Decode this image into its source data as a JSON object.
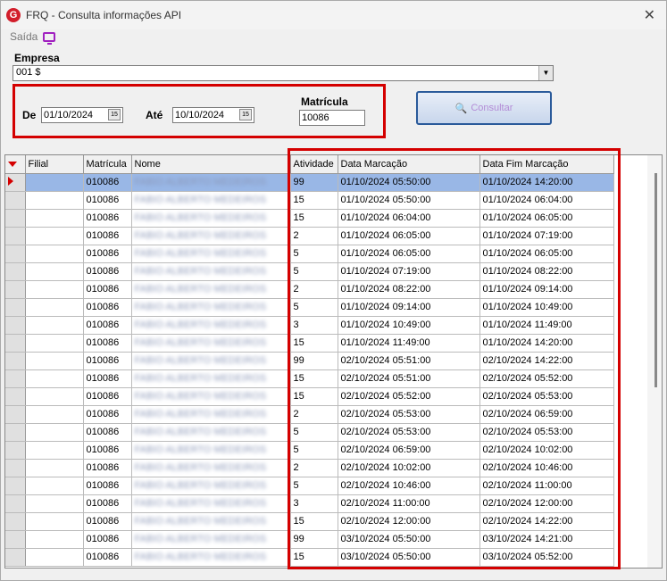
{
  "window": {
    "title": "FRQ - Consulta informações API",
    "icon_letter": "G"
  },
  "menu": {
    "saida_label": "Saída"
  },
  "empresa": {
    "label": "Empresa",
    "value": "001 $"
  },
  "filters": {
    "de_label": "De",
    "de_value": "01/10/2024",
    "ate_label": "Até",
    "ate_value": "10/10/2024",
    "matricula_label": "Matrícula",
    "matricula_value": "10086",
    "consultar_label": "Consultar"
  },
  "grid": {
    "columns": [
      "Filial",
      "Matrícula",
      "Nome",
      "Atividade",
      "Data Marcação",
      "Data Fim Marcação"
    ],
    "rows": [
      {
        "filial": "",
        "matricula": "010086",
        "nome": "FABIO ALBERTO MEDEIROS",
        "atividade": "99",
        "inicio": "01/10/2024 05:50:00",
        "fim": "01/10/2024 14:20:00"
      },
      {
        "filial": "",
        "matricula": "010086",
        "nome": "FABIO ALBERTO MEDEIROS",
        "atividade": "15",
        "inicio": "01/10/2024 05:50:00",
        "fim": "01/10/2024 06:04:00"
      },
      {
        "filial": "",
        "matricula": "010086",
        "nome": "FABIO ALBERTO MEDEIROS",
        "atividade": "15",
        "inicio": "01/10/2024 06:04:00",
        "fim": "01/10/2024 06:05:00"
      },
      {
        "filial": "",
        "matricula": "010086",
        "nome": "FABIO ALBERTO MEDEIROS",
        "atividade": "2",
        "inicio": "01/10/2024 06:05:00",
        "fim": "01/10/2024 07:19:00"
      },
      {
        "filial": "",
        "matricula": "010086",
        "nome": "FABIO ALBERTO MEDEIROS",
        "atividade": "5",
        "inicio": "01/10/2024 06:05:00",
        "fim": "01/10/2024 06:05:00"
      },
      {
        "filial": "",
        "matricula": "010086",
        "nome": "FABIO ALBERTO MEDEIROS",
        "atividade": "5",
        "inicio": "01/10/2024 07:19:00",
        "fim": "01/10/2024 08:22:00"
      },
      {
        "filial": "",
        "matricula": "010086",
        "nome": "FABIO ALBERTO MEDEIROS",
        "atividade": "2",
        "inicio": "01/10/2024 08:22:00",
        "fim": "01/10/2024 09:14:00"
      },
      {
        "filial": "",
        "matricula": "010086",
        "nome": "FABIO ALBERTO MEDEIROS",
        "atividade": "5",
        "inicio": "01/10/2024 09:14:00",
        "fim": "01/10/2024 10:49:00"
      },
      {
        "filial": "",
        "matricula": "010086",
        "nome": "FABIO ALBERTO MEDEIROS",
        "atividade": "3",
        "inicio": "01/10/2024 10:49:00",
        "fim": "01/10/2024 11:49:00"
      },
      {
        "filial": "",
        "matricula": "010086",
        "nome": "FABIO ALBERTO MEDEIROS",
        "atividade": "15",
        "inicio": "01/10/2024 11:49:00",
        "fim": "01/10/2024 14:20:00"
      },
      {
        "filial": "",
        "matricula": "010086",
        "nome": "FABIO ALBERTO MEDEIROS",
        "atividade": "99",
        "inicio": "02/10/2024 05:51:00",
        "fim": "02/10/2024 14:22:00"
      },
      {
        "filial": "",
        "matricula": "010086",
        "nome": "FABIO ALBERTO MEDEIROS",
        "atividade": "15",
        "inicio": "02/10/2024 05:51:00",
        "fim": "02/10/2024 05:52:00"
      },
      {
        "filial": "",
        "matricula": "010086",
        "nome": "FABIO ALBERTO MEDEIROS",
        "atividade": "15",
        "inicio": "02/10/2024 05:52:00",
        "fim": "02/10/2024 05:53:00"
      },
      {
        "filial": "",
        "matricula": "010086",
        "nome": "FABIO ALBERTO MEDEIROS",
        "atividade": "2",
        "inicio": "02/10/2024 05:53:00",
        "fim": "02/10/2024 06:59:00"
      },
      {
        "filial": "",
        "matricula": "010086",
        "nome": "FABIO ALBERTO MEDEIROS",
        "atividade": "5",
        "inicio": "02/10/2024 05:53:00",
        "fim": "02/10/2024 05:53:00"
      },
      {
        "filial": "",
        "matricula": "010086",
        "nome": "FABIO ALBERTO MEDEIROS",
        "atividade": "5",
        "inicio": "02/10/2024 06:59:00",
        "fim": "02/10/2024 10:02:00"
      },
      {
        "filial": "",
        "matricula": "010086",
        "nome": "FABIO ALBERTO MEDEIROS",
        "atividade": "2",
        "inicio": "02/10/2024 10:02:00",
        "fim": "02/10/2024 10:46:00"
      },
      {
        "filial": "",
        "matricula": "010086",
        "nome": "FABIO ALBERTO MEDEIROS",
        "atividade": "5",
        "inicio": "02/10/2024 10:46:00",
        "fim": "02/10/2024 11:00:00"
      },
      {
        "filial": "",
        "matricula": "010086",
        "nome": "FABIO ALBERTO MEDEIROS",
        "atividade": "3",
        "inicio": "02/10/2024 11:00:00",
        "fim": "02/10/2024 12:00:00"
      },
      {
        "filial": "",
        "matricula": "010086",
        "nome": "FABIO ALBERTO MEDEIROS",
        "atividade": "15",
        "inicio": "02/10/2024 12:00:00",
        "fim": "02/10/2024 14:22:00"
      },
      {
        "filial": "",
        "matricula": "010086",
        "nome": "FABIO ALBERTO MEDEIROS",
        "atividade": "99",
        "inicio": "03/10/2024 05:50:00",
        "fim": "03/10/2024 14:21:00"
      },
      {
        "filial": "",
        "matricula": "010086",
        "nome": "FABIO ALBERTO MEDEIROS",
        "atividade": "15",
        "inicio": "03/10/2024 05:50:00",
        "fim": "03/10/2024 05:52:00"
      }
    ]
  },
  "colors": {
    "highlight": "#d40000",
    "selection": "#99b7e6",
    "accent": "#a020c0"
  }
}
